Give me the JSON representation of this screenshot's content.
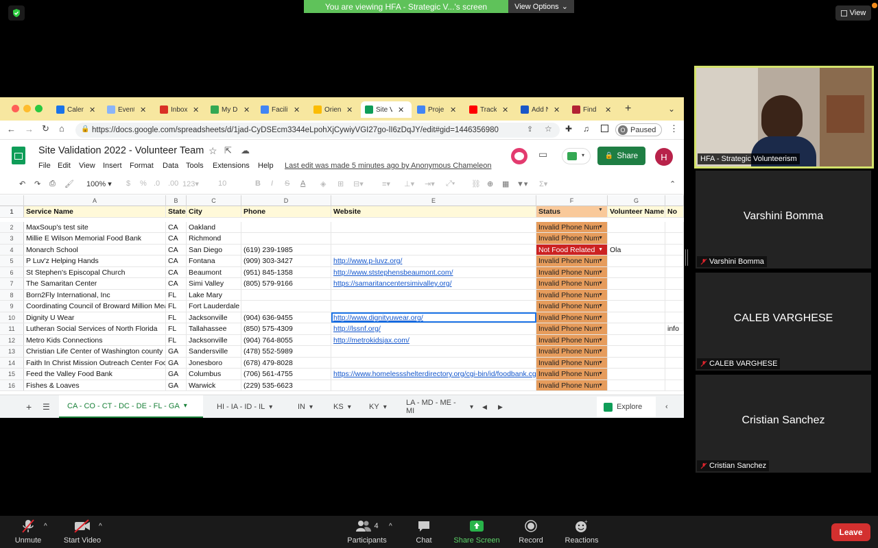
{
  "zoom": {
    "share_banner": "You are viewing HFA - Strategic V...'s screen",
    "view_options": "View Options",
    "view_button": "View",
    "self_label": "HFA - Strategic Volunteerism",
    "participants": [
      {
        "name": "Varshini Bomma",
        "label": "Varshini Bomma"
      },
      {
        "name": "CALEB VARGHESE",
        "label": "CALEB VARGHESE"
      },
      {
        "name": "Cristian Sanchez",
        "label": "Cristian Sanchez"
      }
    ],
    "bottom": {
      "unmute": "Unmute",
      "start_video": "Start Video",
      "participants": "Participants",
      "participants_count": "4",
      "chat": "Chat",
      "share_screen": "Share Screen",
      "record": "Record",
      "reactions": "Reactions",
      "leave": "Leave"
    }
  },
  "browser": {
    "tabs": [
      {
        "label": "Calen",
        "color": "#1a73e8"
      },
      {
        "label": "Event",
        "color": "#8ab4f8"
      },
      {
        "label": "Inbox",
        "color": "#d93025"
      },
      {
        "label": "My Dr",
        "color": "#34a853"
      },
      {
        "label": "Facilit",
        "color": "#4285f4"
      },
      {
        "label": "Orien",
        "color": "#fbbc04"
      },
      {
        "label": "Site V",
        "color": "#0f9d58"
      },
      {
        "label": "Proje",
        "color": "#4285f4"
      },
      {
        "label": "Track",
        "color": "#ff0000"
      },
      {
        "label": "Add N",
        "color": "#1a57c8"
      },
      {
        "label": "Find",
        "color": "#b22234"
      }
    ],
    "url": "https://docs.google.com/spreadsheets/d/1jad-CyDSEcm3344eLpohXjCywiyVGI27go-lI6zDqJY/edit#gid=1446356980",
    "paused": "Paused",
    "profile_initial": "O"
  },
  "sheet": {
    "title": "Site Validation 2022 - Volunteer Team",
    "menus": [
      "File",
      "Edit",
      "View",
      "Insert",
      "Format",
      "Data",
      "Tools",
      "Extensions",
      "Help"
    ],
    "last_edit": "Last edit was made 5 minutes ago by Anonymous Chameleon",
    "share": "Share",
    "avatar": "H",
    "zoom": "100%",
    "font_size": "10",
    "col_letters": [
      "A",
      "B",
      "C",
      "D",
      "E",
      "F",
      "G",
      ""
    ],
    "headers": [
      "Service Name",
      "State",
      "City",
      "Phone",
      "Website",
      "Status",
      "Volunteer Name",
      "No"
    ],
    "rows": [
      {
        "n": "2",
        "name": "MaxSoup's test site",
        "state": "CA",
        "city": "Oakland",
        "phone": "",
        "web": "",
        "status": "Invalid Phone Num",
        "vol": "",
        "note": ""
      },
      {
        "n": "3",
        "name": "Millie E Wilson Memorial Food Bank",
        "state": "CA",
        "city": "Richmond",
        "phone": "",
        "web": "",
        "status": "Invalid Phone Num",
        "vol": "",
        "note": ""
      },
      {
        "n": "4",
        "name": "Monarch School",
        "state": "CA",
        "city": "San Diego",
        "phone": "(619) 239-1985",
        "web": "",
        "status": "Not Food Related",
        "vol": "Ola",
        "note": ""
      },
      {
        "n": "5",
        "name": "P Luv'z Helping Hands",
        "state": "CA",
        "city": "Fontana",
        "phone": "(909) 303-3427",
        "web": "http://www.p-luvz.org/",
        "status": "Invalid Phone Num",
        "vol": "",
        "note": ""
      },
      {
        "n": "6",
        "name": "St Stephen's Episcopal Church",
        "state": "CA",
        "city": "Beaumont",
        "phone": "(951) 845-1358",
        "web": "http://www.ststephensbeaumont.com/",
        "status": "Invalid Phone Num",
        "vol": "",
        "note": ""
      },
      {
        "n": "7",
        "name": "The Samaritan Center",
        "state": "CA",
        "city": "Simi Valley",
        "phone": "(805) 579-9166",
        "web": "https://samaritancentersimivalley.org/",
        "status": "Invalid Phone Num",
        "vol": "",
        "note": ""
      },
      {
        "n": "8",
        "name": "Born2Fly International, Inc",
        "state": "FL",
        "city": "Lake Mary",
        "phone": "",
        "web": "",
        "status": "Invalid Phone Num",
        "vol": "",
        "note": ""
      },
      {
        "n": "9",
        "name": "Coordinating Council of Broward Million Mea",
        "state": "FL",
        "city": "Fort Lauderdale",
        "phone": "",
        "web": "",
        "status": "Invalid Phone Num",
        "vol": "",
        "note": ""
      },
      {
        "n": "10",
        "name": "Dignity U Wear",
        "state": "FL",
        "city": "Jacksonville",
        "phone": "(904) 636-9455",
        "web": "http://www.dignityuwear.org/",
        "status": "Invalid Phone Num",
        "vol": "",
        "note": ""
      },
      {
        "n": "11",
        "name": "Lutheran Social Services of North Florida",
        "state": "FL",
        "city": "Tallahassee",
        "phone": "(850) 575-4309",
        "web": "http://lssnf.org/",
        "status": "Invalid Phone Num",
        "vol": "",
        "note": "info"
      },
      {
        "n": "12",
        "name": "Metro Kids Connections",
        "state": "FL",
        "city": "Jacksonville",
        "phone": "(904) 764-8055",
        "web": "http://metrokidsjax.com/",
        "status": "Invalid Phone Num",
        "vol": "",
        "note": ""
      },
      {
        "n": "13",
        "name": "Christian Life Center of Washington county",
        "state": "GA",
        "city": "Sandersville",
        "phone": "(478) 552-5989",
        "web": "",
        "status": "Invalid Phone Num",
        "vol": "",
        "note": ""
      },
      {
        "n": "14",
        "name": "Faith In Christ Mission Outreach Center Foo",
        "state": "GA",
        "city": "Jonesboro",
        "phone": "(678) 479-8028",
        "web": "",
        "status": "Invalid Phone Num",
        "vol": "",
        "note": ""
      },
      {
        "n": "15",
        "name": "Feed the Valley Food Bank",
        "state": "GA",
        "city": "Columbus",
        "phone": "(706) 561-4755",
        "web": "https://www.homelessshelterdirectory.org/cgi-bin/id/foodbank.cgi",
        "status": "Invalid Phone Num",
        "vol": "",
        "note": ""
      },
      {
        "n": "16",
        "name": "Fishes & Loaves",
        "state": "GA",
        "city": "Warwick",
        "phone": "(229) 535-6623",
        "web": "",
        "status": "Invalid Phone Num",
        "vol": "",
        "note": ""
      }
    ],
    "sheet_tabs": [
      "CA - CO - CT - DC - DE - FL - GA",
      "HI - IA - ID - IL",
      "IN",
      "KS",
      "KY",
      "LA - MD - ME - MI"
    ],
    "explore": "Explore"
  }
}
